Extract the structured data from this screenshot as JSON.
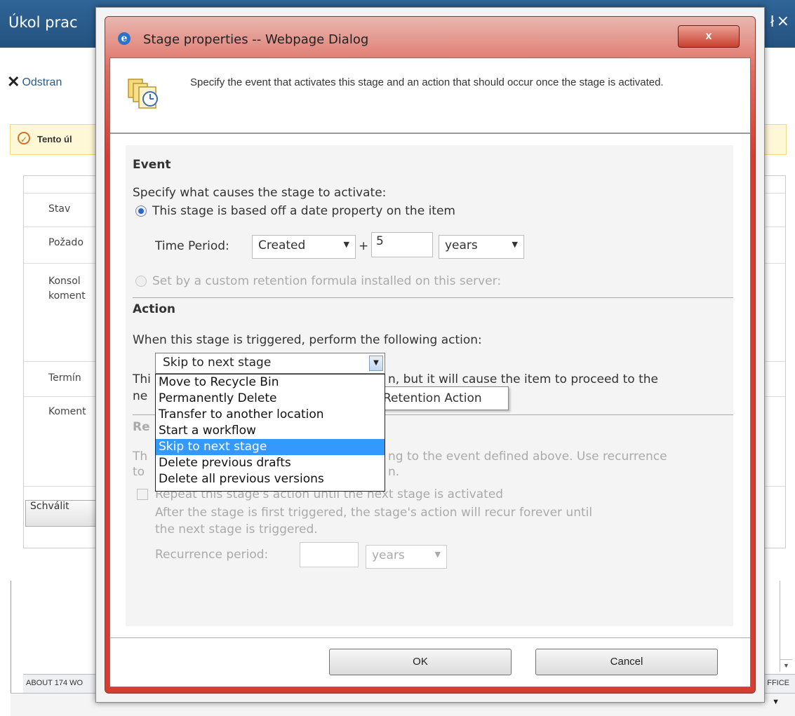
{
  "background": {
    "title": "Úkol prac",
    "close_glyph": "×",
    "help_glyph": "ł",
    "remove_icon": "✕",
    "remove_label": "Odstran",
    "banner_text": "Tento úl",
    "labels": [
      "Stav",
      "Požado",
      "Konsol",
      "koment",
      "Termín",
      "Koment"
    ],
    "approve_button": "Schválit",
    "status_left": "ABOUT 174 WO",
    "status_right": "FFICE",
    "bottom_arrow": "▼",
    "scroll_arrow": "▼"
  },
  "dialog": {
    "title": "Stage properties -- Webpage Dialog",
    "close_glyph": "x",
    "ie_glyph": "e",
    "header_text": "Specify the event that activates this stage and an action that should occur once the stage is activated.",
    "event": {
      "title": "Event",
      "prompt": "Specify what causes the stage to activate:",
      "option_date": "This stage is based off a date property on the item",
      "time_period_label": "Time Period:",
      "property_value": "Created",
      "plus": "+",
      "amount_value": "5",
      "unit_value": "years",
      "option_formula": "Set by a custom retention formula installed on this server:"
    },
    "action": {
      "title": "Action",
      "prompt": "When this stage is triggered, perform the following action:",
      "selected": "Skip to next stage",
      "description_start": "Thi",
      "description_end": "n, but it will cause the item to proceed to the",
      "description_line2_start": "ne",
      "tooltip": "Retention Action",
      "options": [
        "Move to Recycle Bin",
        "Permanently Delete",
        "Transfer to another location",
        "Start a workflow",
        "Skip to next stage",
        "Delete previous drafts",
        "Delete all previous versions"
      ],
      "highlighted_index": 4
    },
    "recurrence": {
      "title_partial": "Re",
      "desc_line1_start": "Th",
      "desc_line1_end": "ng to the event defined above. Use recurrence",
      "desc_line2_start": "to",
      "desc_line2_end": "n.",
      "checkbox_label": "Repeat this stage's action until the next stage is activated",
      "help_line1": "After the stage is first triggered, the stage's action will recur forever until",
      "help_line2": "the next stage is triggered.",
      "period_label": "Recurrence period:",
      "period_value": "",
      "unit_value": "years"
    },
    "ok_label": "OK",
    "cancel_label": "Cancel"
  }
}
